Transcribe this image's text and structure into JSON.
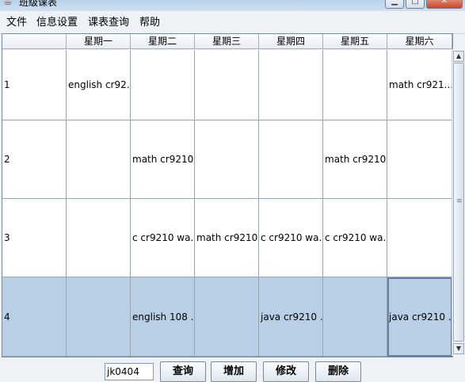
{
  "window": {
    "title": "班级课表",
    "icon": "java-cup-icon",
    "controls": [
      "minimize",
      "maximize",
      "close"
    ]
  },
  "menubar": {
    "items": [
      "文件",
      "信息设置",
      "课表查询",
      "帮助"
    ]
  },
  "table": {
    "columns": [
      "",
      "星期一",
      "星期二",
      "星期三",
      "星期四",
      "星期五",
      "星期六"
    ],
    "rows": [
      {
        "period": "1",
        "cells": [
          "english cr92...",
          "",
          "",
          "",
          "",
          "math cr921..."
        ]
      },
      {
        "period": "2",
        "cells": [
          "",
          "math cr9210...",
          "",
          "",
          "math cr9210...",
          ""
        ]
      },
      {
        "period": "3",
        "cells": [
          "",
          "c cr9210 wa...",
          "math cr9210...",
          "c cr9210 wa...",
          "c cr9210 wa...",
          ""
        ]
      },
      {
        "period": "4",
        "cells": [
          "",
          "english 108 ...",
          "",
          "java cr9210 ...",
          "",
          "java cr9210 ..."
        ]
      }
    ],
    "selected_row": 3,
    "focused_cell": {
      "row": 3,
      "col": 5
    },
    "colors": {
      "selection": "#b8cfe5",
      "grid": "#9aa4b0"
    }
  },
  "footer": {
    "class_input_value": "jk0404",
    "buttons": {
      "query": "查询",
      "add": "增加",
      "edit": "修改",
      "delete": "删除"
    }
  }
}
